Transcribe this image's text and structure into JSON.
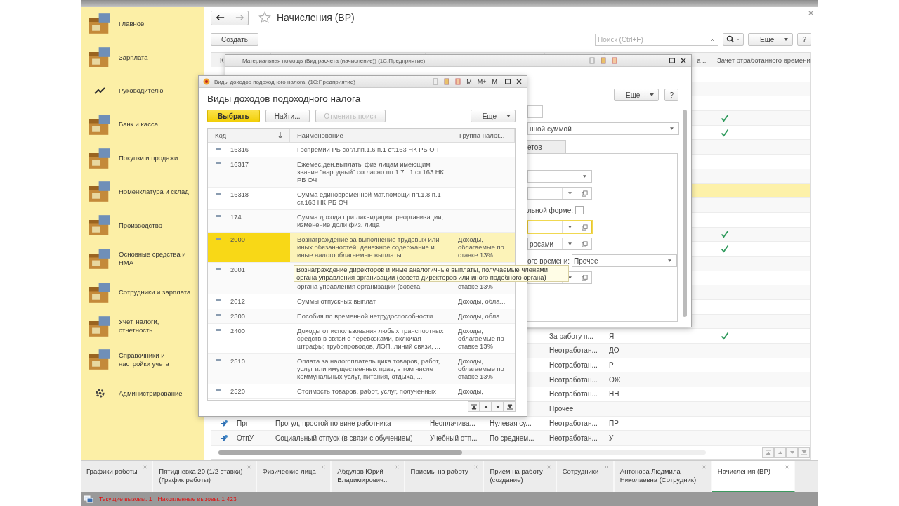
{
  "sidebar": {
    "items": [
      {
        "label": "Главное"
      },
      {
        "label": "Зарплата"
      },
      {
        "label": "Руководителю"
      },
      {
        "label": "Банк и касса"
      },
      {
        "label": "Покупки и продажи"
      },
      {
        "label": "Номенклатура и склад"
      },
      {
        "label": "Производство"
      },
      {
        "label": "Основные средства и НМА"
      },
      {
        "label": "Сотрудники и зарплата"
      },
      {
        "label": "Учет, налоги, отчетность"
      },
      {
        "label": "Справочники и настройки учета"
      },
      {
        "label": "Администрирование"
      }
    ]
  },
  "page": {
    "title": "Начисления (ВР)",
    "create_button": "Создать",
    "search": {
      "placeholder": "Поиск (Ctrl+F)"
    },
    "more_button": "Еще",
    "help_button": "?"
  },
  "table": {
    "columns": {
      "column_1": "К",
      "column_6": "а ...",
      "column_7": "Зачет отработанного времени"
    },
    "rows": [
      {
        "selected": false,
        "time_credit": false
      },
      {
        "selected": false,
        "time_credit": false
      },
      {
        "selected": false,
        "time_credit": false
      },
      {
        "selected": false,
        "time_credit": true
      },
      {
        "selected": false,
        "time_credit": true
      },
      {
        "selected": false,
        "time_credit": false
      },
      {
        "selected": false,
        "time_credit": false
      },
      {
        "selected": false,
        "time_credit": false
      },
      {
        "selected": true,
        "time_credit": false
      },
      {
        "selected": false,
        "time_credit": false
      },
      {
        "selected": false,
        "time_credit": false
      },
      {
        "selected": false,
        "time_credit": true
      },
      {
        "selected": false,
        "time_credit": true
      },
      {
        "selected": false,
        "time_credit": false
      },
      {
        "selected": false,
        "time_credit": false
      },
      {
        "selected": false,
        "time_credit": false
      },
      {
        "selected": false,
        "time_credit": false
      },
      {
        "selected": false,
        "time_credit": false
      },
      {
        "selected": false,
        "time_credit": true,
        "column_5": "За работу п...",
        "column_6": "Я"
      },
      {
        "selected": false,
        "time_credit": false,
        "column_5": "Неотработан...",
        "column_6": "ДО"
      },
      {
        "selected": false,
        "time_credit": false,
        "column_5": "Неотработан...",
        "column_6": "Р"
      },
      {
        "selected": false,
        "time_credit": false,
        "column_5": "Неотработан...",
        "column_6": "ОЖ"
      },
      {
        "selected": false,
        "time_credit": false,
        "column_5": "Неотработан...",
        "column_6": "НН"
      },
      {
        "selected": false,
        "time_credit": false,
        "column_5": "Прочее"
      },
      {
        "selected": false,
        "time_credit": false,
        "code": "Прг",
        "name": "Прогул, простой по вине работника",
        "column_3": "Неоплачива...",
        "column_4": "Нулевая су...",
        "column_5": "Неотработан...",
        "column_6": "ПР"
      },
      {
        "selected": false,
        "time_credit": false,
        "code": "ОтпУ",
        "name": "Социальный отпуск (в связи с обучением)",
        "column_3": "Учебный отп...",
        "column_4": "По среднем...",
        "column_5": "Неотработан...",
        "column_6": "У"
      }
    ]
  },
  "material_dialog": {
    "title": "Материальная помощь (Вид расчета (начисление)) (1С:Предприятие)",
    "more_button": "Еще",
    "help_button": "?",
    "calc_method": "нной суммой",
    "tab": "етов",
    "fields": [
      {
        "kind": "select"
      },
      {
        "kind": "select_open",
        "focused": false
      },
      {
        "kind": "checkbox",
        "label": "льной форме:",
        "checked": false
      },
      {
        "kind": "select_open",
        "focused": true
      },
      {
        "kind": "select_open",
        "focused": false,
        "value": "росами"
      },
      {
        "kind": "labeled_select",
        "label": "ого времени:",
        "value": "Прочее"
      },
      {
        "kind": "select_open",
        "focused": false
      }
    ]
  },
  "income_dialog": {
    "window_title": "Виды доходов подоходного налога  (1С:Предприятие)",
    "memory_buttons": [
      "M",
      "M+",
      "M-"
    ],
    "heading": "Виды доходов подоходного налога",
    "buttons": [
      {
        "label": "Выбрать",
        "kind": "default",
        "disabled": false
      },
      {
        "label": "Найти...",
        "kind": "normal",
        "disabled": false
      },
      {
        "label": "Отменить поиск",
        "kind": "normal",
        "disabled": true
      }
    ],
    "more_button": "Еще",
    "columns": [
      "Код",
      "Наименование",
      "Группа налог..."
    ],
    "rows": [
      {
        "code": "16316",
        "name": "Госпремии РБ согл.пп.1.6 п.1 ст.163 НК РБ ОЧ",
        "selected": false
      },
      {
        "code": "16317",
        "name": "Ежемес.ден.выплаты физ лицам имеющим звание \"народный\" согласно пп.1.7п.1 ст.163 НК РБ ОЧ",
        "selected": false
      },
      {
        "code": "16318",
        "name": "Сумма единовременной мат.помощи пп.1.8 п.1 ст.163 НК РБ ОЧ",
        "selected": false
      },
      {
        "code": "174",
        "name": "Сумма дохода при ликвидации, реорганизации, изменение доли физ. лица",
        "selected": false
      },
      {
        "code": "2000",
        "name": "Вознаграждение за выполнение трудовых или иных обязанностей; денежное содержание и иные налогооблагаемые выплаты ...",
        "group": "Доходы, облагаемые по ставке 13%",
        "selected": true
      },
      {
        "code": "2001",
        "kind": "covered",
        "name": "органа управления организации (совета",
        "group": "ставке 13%",
        "selected": false
      },
      {
        "code": "2012",
        "name": "Суммы отпускных выплат",
        "group": "Доходы, обла...",
        "selected": false
      },
      {
        "code": "2300",
        "name": "Пособия по временной нетрудоспособности",
        "group": "Доходы, обла...",
        "selected": false
      },
      {
        "code": "2400",
        "name": "Доходы от использования любых транспортных средств в связи с перевозками, включая штрафы; трубопроводов, ЛЭП, линий связи, ...",
        "group": "Доходы, облагаемые по ставке 13%",
        "selected": false
      },
      {
        "code": "2510",
        "name": "Оплата за налогоплательщика товаров, работ, услуг или имущественных прав, в том числе коммунальных услуг, питания, отдыха, ...",
        "group": "Доходы, облагаемые по ставке 13%",
        "selected": false
      },
      {
        "code": "2520",
        "name": "Стоимость товаров, работ, услуг, полученных",
        "group": "Доходы,",
        "selected": false
      }
    ],
    "tooltip": "Вознаграждение директоров и иные аналогичные выплаты, получаемые членами органа управления организации (совета директоров или иного подобного органа)"
  },
  "taskbar": {
    "tabs": [
      {
        "label": "Графики работы",
        "selected": false
      },
      {
        "label": "Пятидневка 20 (1/2 ставки)\n(График работы)",
        "selected": false
      },
      {
        "label": "Физические лица",
        "selected": false
      },
      {
        "label": "Абдулов Юрий\nВладимирович...",
        "selected": false
      },
      {
        "label": "Приемы на работу",
        "selected": false
      },
      {
        "label": "Прием на работу\n(создание)",
        "selected": false
      },
      {
        "label": "Сотрудники",
        "selected": false
      },
      {
        "label": "Антонова Людмила\nНиколаевна (Сотрудник)",
        "selected": false
      },
      {
        "label": "Начисления (ВР)",
        "selected": true
      }
    ]
  },
  "status_bar": {
    "current_calls": "Текущие вызовы: 1",
    "total_calls": "Накопленные вызовы: 1 423"
  }
}
